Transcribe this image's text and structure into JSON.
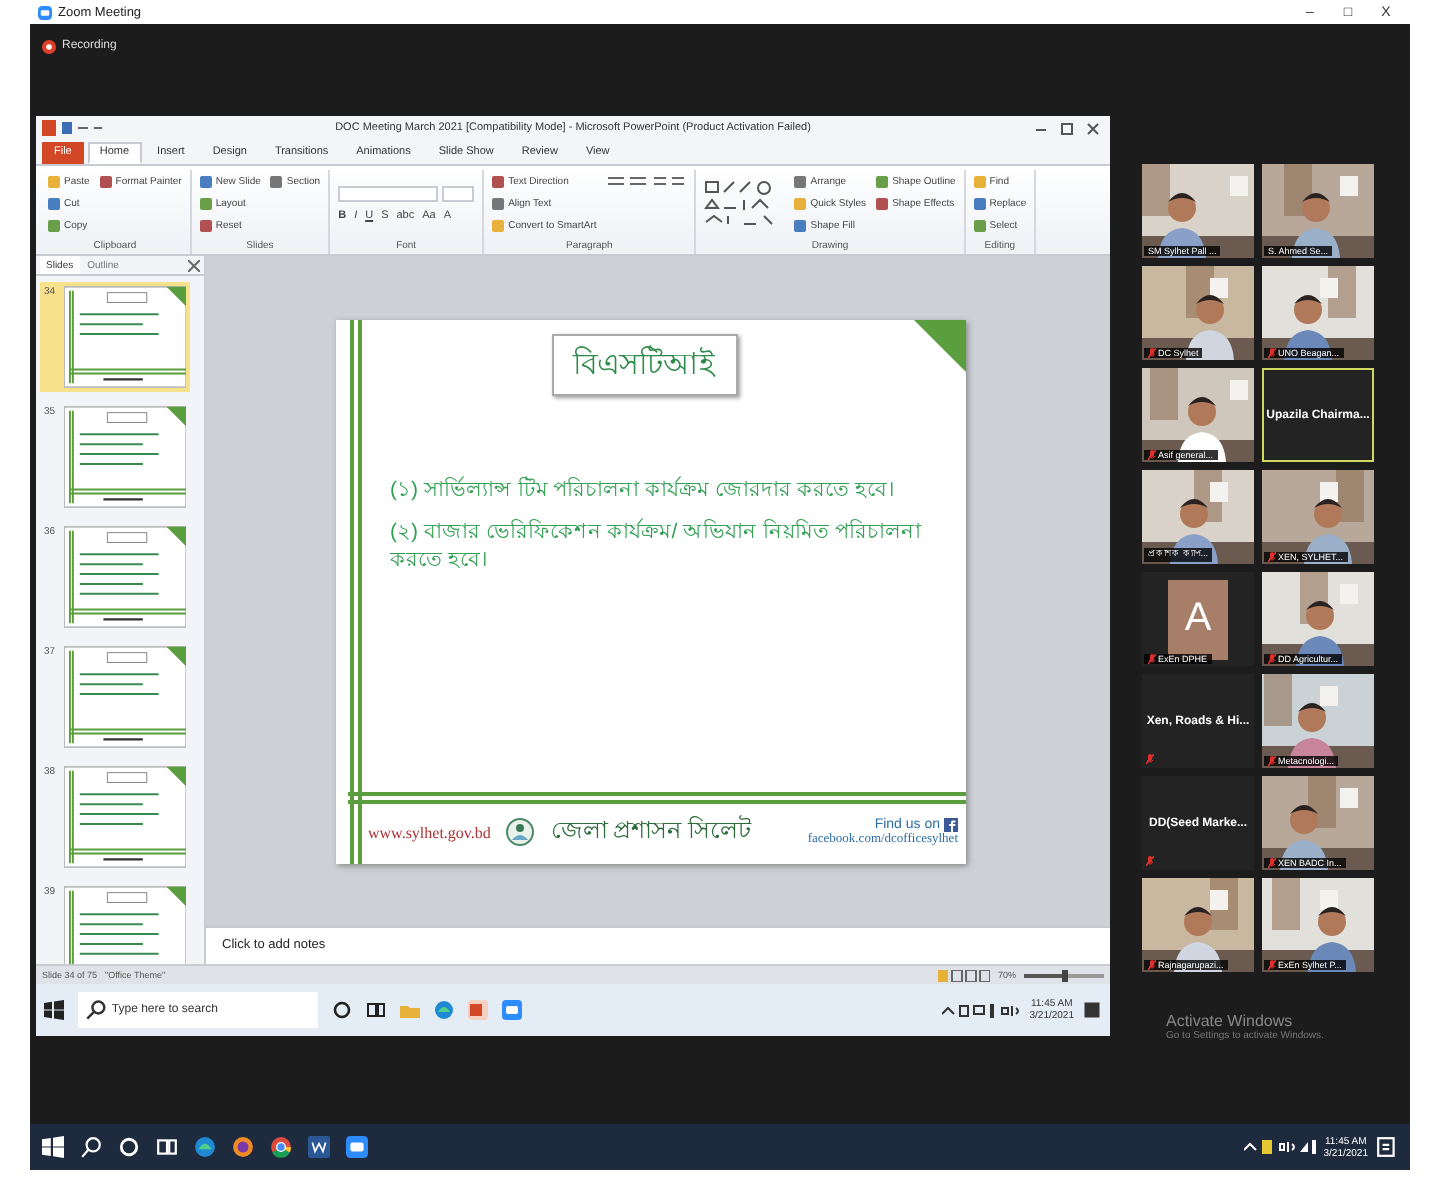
{
  "window": {
    "title": "Zoom Meeting",
    "controls": [
      "–",
      "□",
      "X"
    ]
  },
  "recording": {
    "label": "Recording"
  },
  "powerpoint": {
    "title": "DOC Meeting March 2021 [Compatibility Mode] - Microsoft PowerPoint (Product Activation Failed)",
    "tabs": [
      {
        "label": "File",
        "kind": "file",
        "selected": false
      },
      {
        "label": "Home",
        "kind": "tab",
        "selected": true
      },
      {
        "label": "Insert",
        "kind": "tab",
        "selected": false
      },
      {
        "label": "Design",
        "kind": "tab",
        "selected": false
      },
      {
        "label": "Transitions",
        "kind": "tab",
        "selected": false
      },
      {
        "label": "Animations",
        "kind": "tab",
        "selected": false
      },
      {
        "label": "Slide Show",
        "kind": "tab",
        "selected": false
      },
      {
        "label": "Review",
        "kind": "tab",
        "selected": false
      },
      {
        "label": "View",
        "kind": "tab",
        "selected": false
      }
    ],
    "ribbon": [
      {
        "label": "Clipboard",
        "items": [
          "Paste",
          "Cut",
          "Copy",
          "Format Painter"
        ]
      },
      {
        "label": "Slides",
        "items": [
          "New Slide",
          "Layout",
          "Reset",
          "Section"
        ]
      },
      {
        "label": "Font",
        "format_buttons": [
          "B",
          "I",
          "U",
          "S",
          "abc",
          "Aa",
          "A"
        ]
      },
      {
        "label": "Paragraph",
        "items": [
          "Text Direction",
          "Align Text",
          "Convert to SmartArt"
        ]
      },
      {
        "label": "Drawing",
        "items": [
          "Arrange",
          "Quick Styles",
          "Shape Fill",
          "Shape Outline",
          "Shape Effects"
        ]
      },
      {
        "label": "Editing",
        "items": [
          "Find",
          "Replace",
          "Select"
        ]
      }
    ],
    "slides_pane": {
      "tabs": [
        {
          "label": "Slides",
          "selected": true
        },
        {
          "label": "Outline",
          "selected": false
        }
      ],
      "slides": [
        {
          "number": "34",
          "selected": true
        },
        {
          "number": "35",
          "selected": false
        },
        {
          "number": "36",
          "selected": false
        },
        {
          "number": "37",
          "selected": false
        },
        {
          "number": "38",
          "selected": false
        },
        {
          "number": "39",
          "selected": false
        }
      ]
    },
    "slide": {
      "title": "বিএসটিআই",
      "points": [
        "(১) সার্ভিল্যান্স টিম পরিচালনা কার্যক্রম জোরদার করতে হবে।",
        "(২) বাজার ভেরিফিকেশন কার্যক্রম/ অভিযান নিয়মিত পরিচালনা করতে হবে।"
      ],
      "footer": {
        "website": "www.sylhet.gov.bd",
        "office": "জেলা প্রশাসন সিলেট",
        "find_us": "Find us on",
        "facebook": "facebook.com/dcofficesylhet"
      }
    },
    "notes": {
      "placeholder": "Click to add notes"
    },
    "status_bar": {
      "slide": "Slide 34 of 75",
      "theme": "\"Office Theme\"",
      "zoom": {
        "reading": "70%",
        "level": 0.5
      }
    },
    "taskbar": {
      "search": {
        "placeholder": "Type here to search"
      },
      "time": "11:45 AM",
      "date": "3/21/2021"
    }
  },
  "gallery": [
    {
      "name": "SM Sylhet Pall ...",
      "kind": "video",
      "muted": false,
      "highlighted": false
    },
    {
      "name": "S. Ahmed Se...",
      "kind": "video",
      "muted": false,
      "highlighted": false
    },
    {
      "name": "DC Sylhet",
      "kind": "video",
      "muted": true,
      "highlighted": false
    },
    {
      "name": "UNO Beagan...",
      "kind": "video",
      "muted": true,
      "highlighted": false
    },
    {
      "name": "Asif general...",
      "kind": "video",
      "muted": true,
      "highlighted": false
    },
    {
      "name": "Upazila Chairma...",
      "kind": "name",
      "muted": false,
      "highlighted": true
    },
    {
      "name": "প্রকাশক ক্যাপ...",
      "kind": "video",
      "muted": false,
      "highlighted": false
    },
    {
      "name": "XEN, SYLHET...",
      "kind": "video",
      "muted": true,
      "highlighted": false
    },
    {
      "name": "ExEn DPHE",
      "kind": "avatar",
      "initial": "A",
      "muted": true,
      "highlighted": false
    },
    {
      "name": "DD Agricultur...",
      "kind": "video",
      "muted": true,
      "highlighted": false
    },
    {
      "name": "Xen, Roads & Hi...",
      "kind": "name",
      "muted": true,
      "highlighted": false
    },
    {
      "name": "Metacnologi...",
      "kind": "video",
      "muted": true,
      "highlighted": false
    },
    {
      "name": "DD(Seed Marke...",
      "kind": "name",
      "muted": true,
      "highlighted": false
    },
    {
      "name": "XEN BADC In...",
      "kind": "video",
      "muted": true,
      "highlighted": false
    },
    {
      "name": "Rajnagarupazi...",
      "kind": "video",
      "muted": true,
      "highlighted": false
    },
    {
      "name": "ExEn Sylhet P...",
      "kind": "video",
      "muted": true,
      "highlighted": false
    }
  ],
  "activation": {
    "title": "Activate Windows",
    "hint": "Go to Settings to activate Windows."
  },
  "taskbar": {
    "time": "11:45 AM",
    "date": "3/21/2021"
  }
}
